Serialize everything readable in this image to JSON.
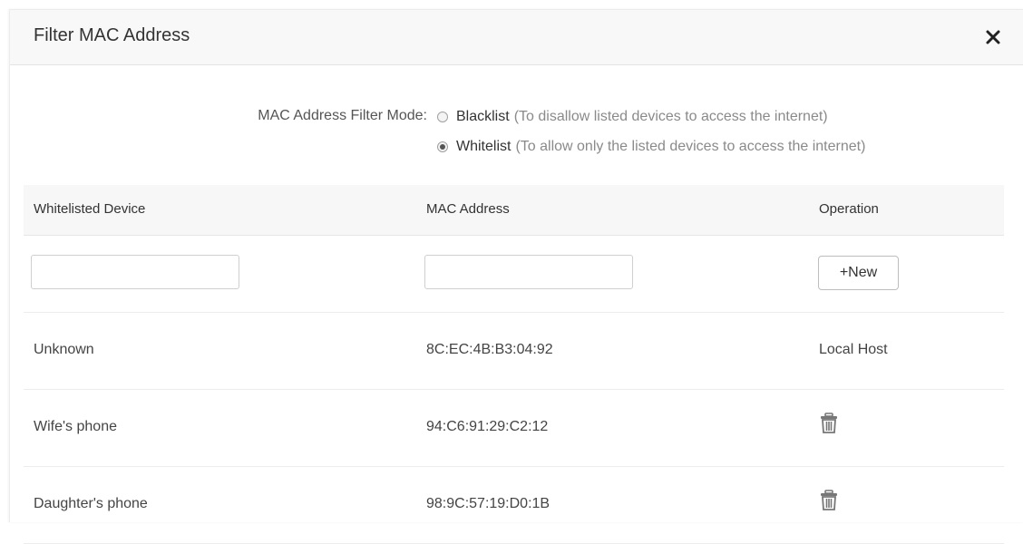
{
  "dialog": {
    "title": "Filter MAC Address",
    "close_icon": "close-icon"
  },
  "mode": {
    "label": "MAC Address Filter Mode:",
    "options": [
      {
        "name": "Blacklist",
        "desc": "(To disallow listed devices to access the internet)",
        "checked": false
      },
      {
        "name": "Whitelist",
        "desc": "(To allow only the listed devices to access the internet)",
        "checked": true
      }
    ]
  },
  "table": {
    "headers": [
      "Whitelisted Device",
      "MAC Address",
      "Operation"
    ],
    "device_input": {
      "value": "",
      "placeholder": ""
    },
    "mac_input": {
      "value": "",
      "placeholder": ""
    },
    "new_button": "+New",
    "rows": [
      {
        "device": "Unknown",
        "mac": "8C:EC:4B:B3:04:92",
        "operation": "Local Host",
        "icon": null
      },
      {
        "device": "Wife's phone",
        "mac": "94:C6:91:29:C2:12",
        "operation": "",
        "icon": "trash-icon"
      },
      {
        "device": "Daughter's phone",
        "mac": "98:9C:57:19:D0:1B",
        "operation": "",
        "icon": "trash-icon"
      }
    ]
  },
  "colors": {
    "header_bg": "#f8f8f8",
    "table_header_bg": "#f7f7f7",
    "text": "#333333",
    "muted_text": "#8a8a8a"
  }
}
